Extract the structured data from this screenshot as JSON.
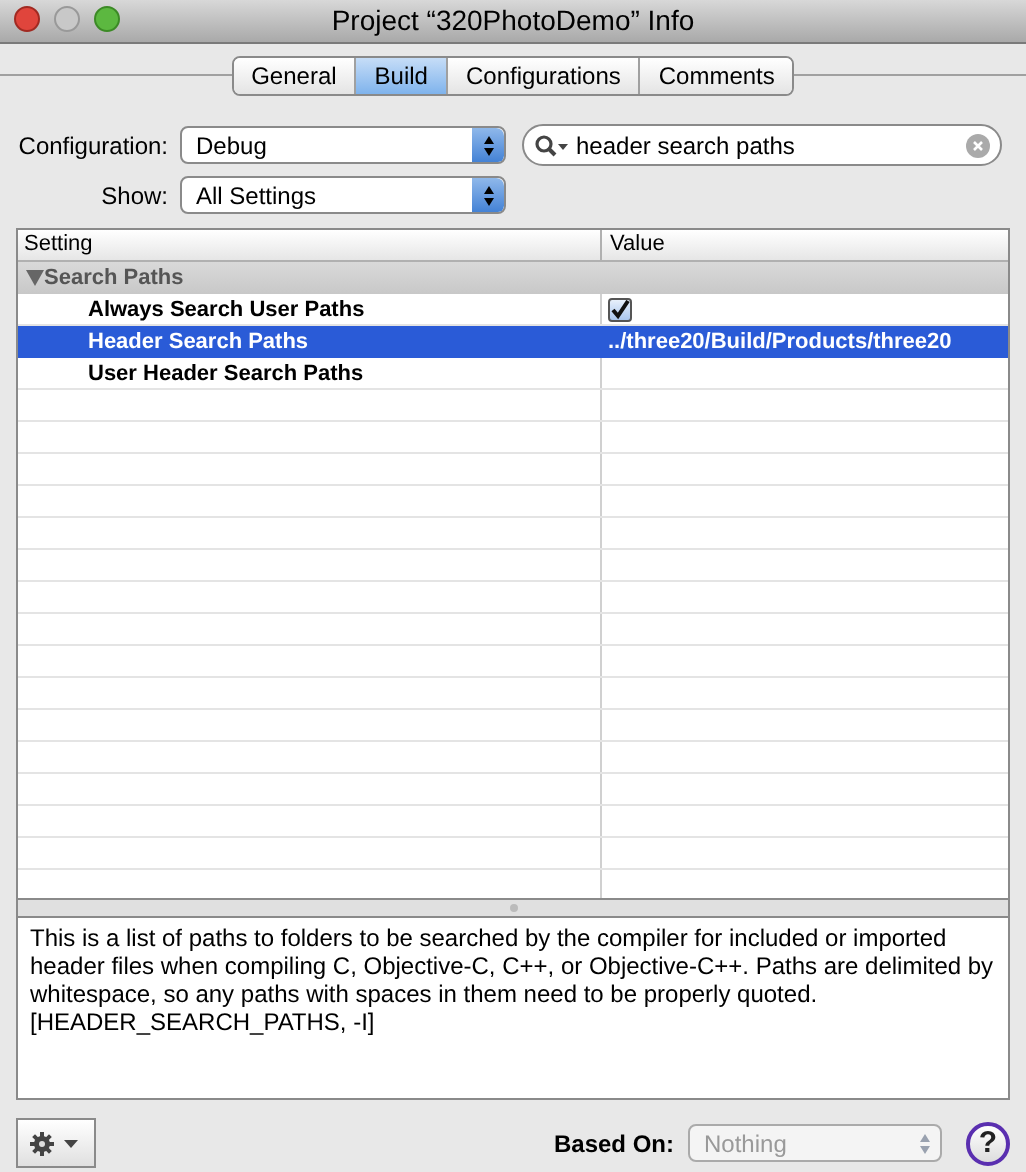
{
  "window": {
    "title": "Project “320PhotoDemo” Info"
  },
  "tabs": [
    {
      "label": "General",
      "selected": false
    },
    {
      "label": "Build",
      "selected": true
    },
    {
      "label": "Configurations",
      "selected": false
    },
    {
      "label": "Comments",
      "selected": false
    }
  ],
  "configuration": {
    "label": "Configuration:",
    "value": "Debug"
  },
  "show": {
    "label": "Show:",
    "value": "All Settings"
  },
  "search": {
    "value": "header search paths"
  },
  "table": {
    "columns": [
      "Setting",
      "Value"
    ],
    "rows": [
      {
        "kind": "group",
        "setting": "Search Paths",
        "expanded": true,
        "selected": false
      },
      {
        "kind": "checkbox",
        "setting": "Always Search User Paths",
        "checked": true,
        "selected": false
      },
      {
        "kind": "text",
        "setting": "Header Search Paths",
        "value": "../three20/Build/Products/three20",
        "selected": true
      },
      {
        "kind": "text",
        "setting": "User Header Search Paths",
        "value": "",
        "selected": false
      }
    ]
  },
  "description": "This is a list of paths to folders to be searched by the compiler for included or imported header files when compiling C, Objective-C, C++, or Objective-C++. Paths are delimited by whitespace, so any paths with spaces in them need to be properly quoted. [HEADER_SEARCH_PATHS, -I]",
  "footer": {
    "based_on_label": "Based On:",
    "based_on_value": "Nothing",
    "help": "?"
  }
}
